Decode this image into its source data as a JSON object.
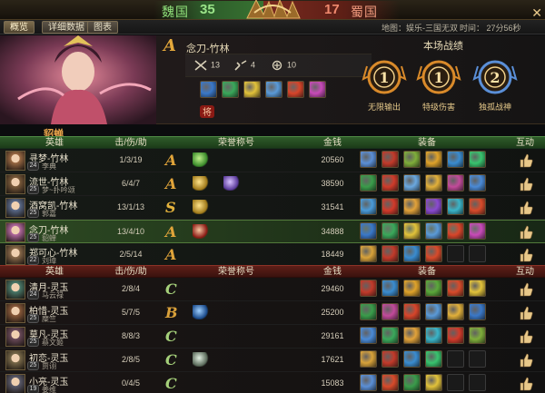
{
  "top": {
    "left_team": "魏国",
    "left_score": "35",
    "right_team": "蜀国",
    "right_score": "17",
    "map_label": "地图：娱乐-三国无双",
    "time_label": "时间：  27分56秒"
  },
  "tabs": [
    "概览",
    "详细数据",
    "图表"
  ],
  "player": {
    "grade": "A",
    "name": "念刀-竹林",
    "kills": "13",
    "deaths": "4",
    "assists": "10",
    "hero_title": "貂蝉"
  },
  "battle": {
    "title": "本场战绩",
    "medals": [
      {
        "label": "无限输出",
        "rank": "1",
        "color": "#d98a2a"
      },
      {
        "label": "特级伤害",
        "rank": "1",
        "color": "#d98a2a"
      },
      {
        "label": "独孤战神",
        "rank": "2",
        "color": "#5a8fd8"
      }
    ]
  },
  "columns": {
    "hero": "英雄",
    "kda": "击/伤/助",
    "honor": "荣誉称号",
    "money": "金钱",
    "equip": "装备",
    "interact": "互动"
  },
  "green_rows": [
    {
      "hero": "寻梦-竹林",
      "level": "24",
      "player": "李典",
      "kda": "1/3/19",
      "grade": "A",
      "money": "20560",
      "honors": [
        "green"
      ],
      "equip": [
        "#5b8fd6",
        "#c23a2a",
        "#7fae3a",
        "#e0a32a",
        "#3a8ccf",
        "#38c46e"
      ],
      "avatar": "#9b6a44"
    },
    {
      "hero": "流世-竹林",
      "level": "25",
      "player": "梦~扑吟颂",
      "kda": "6/4/7",
      "grade": "A",
      "money": "38590",
      "honors": [
        "gold",
        "purple"
      ],
      "equip": [
        "#3a9c4a",
        "#cf3b2a",
        "#6aa8e0",
        "#e2b03a",
        "#c24a9a",
        "#4a8ad6"
      ],
      "avatar": "#7a5a3a"
    },
    {
      "hero": "酒窝凯-竹林",
      "level": "25",
      "player": "郭嘉",
      "kda": "13/1/13",
      "grade": "S",
      "money": "31541",
      "honors": [
        "gold"
      ],
      "equip": [
        "#4a9ad8",
        "#d23a2a",
        "#e2a23a",
        "#8a4ad0",
        "#3ab4c8",
        "#d84a2a"
      ],
      "avatar": "#5a6a8a"
    },
    {
      "hero": "念刀-竹林",
      "level": "25",
      "player": "貂蝉",
      "kda": "13/4/10",
      "grade": "A",
      "money": "34888",
      "honors": [
        "red"
      ],
      "equip": [
        "#3a78c8",
        "#3aa85a",
        "#e2c23a",
        "#5a9ad8",
        "#d8452a",
        "#c84ab8"
      ],
      "avatar": "#b46aa0",
      "selected": true
    },
    {
      "hero": "郑可心-竹林",
      "level": "22",
      "player": "刘璋",
      "kda": "2/5/14",
      "grade": "A",
      "money": "18449",
      "honors": [],
      "equip": [
        "#d8a23a",
        "#c23a2a",
        "#3a8cd0",
        "#d84a2a",
        "#222222",
        "#222222"
      ],
      "avatar": "#8a6a4a"
    }
  ],
  "red_rows": [
    {
      "hero": "清月-灵玉",
      "level": "24",
      "player": "马云禄",
      "kda": "2/8/4",
      "grade": "C",
      "money": "29460",
      "honors": [],
      "equip": [
        "#c23a2a",
        "#3a8ccf",
        "#e0a32a",
        "#5aa83a",
        "#d84a2a",
        "#e2c23a"
      ],
      "avatar": "#4a7a6a"
    },
    {
      "hero": "柏惜-灵玉",
      "level": "25",
      "player": "糜竺",
      "kda": "5/7/5",
      "grade": "B",
      "money": "25200",
      "honors": [
        "blue"
      ],
      "equip": [
        "#3a9c4a",
        "#c24a9a",
        "#d8452a",
        "#5a9ad8",
        "#e2b03a",
        "#3a78c8"
      ],
      "avatar": "#8a5a3a"
    },
    {
      "hero": "莫凡-灵玉",
      "level": "25",
      "player": "蔡文姬",
      "kda": "8/8/3",
      "grade": "C",
      "money": "29161",
      "honors": [],
      "equip": [
        "#4a8ad6",
        "#3aa85a",
        "#e2a23a",
        "#3ab4c8",
        "#d23a2a",
        "#7fae3a"
      ],
      "avatar": "#6a4a5a"
    },
    {
      "hero": "初恋-灵玉",
      "level": "25",
      "player": "贾诩",
      "kda": "2/8/5",
      "grade": "C",
      "money": "17621",
      "honors": [
        "silver"
      ],
      "equip": [
        "#d8a23a",
        "#c23a2a",
        "#3a8cd0",
        "#38c46e",
        "#222222",
        "#222222"
      ],
      "avatar": "#7a6a4a"
    },
    {
      "hero": "小亮-灵玉",
      "level": "19",
      "player": "姜维",
      "kda": "0/4/5",
      "grade": "C",
      "money": "15083",
      "honors": [],
      "equip": [
        "#5b8fd6",
        "#d84a2a",
        "#3a9c4a",
        "#e2c23a",
        "#222222",
        "#222222"
      ],
      "avatar": "#5a5a6a"
    }
  ],
  "colors": {
    "grade_S": "#e3b23c",
    "grade_A": "#e0a43a",
    "grade_B": "#d8a03a",
    "grade_C": "#a5d07a"
  }
}
